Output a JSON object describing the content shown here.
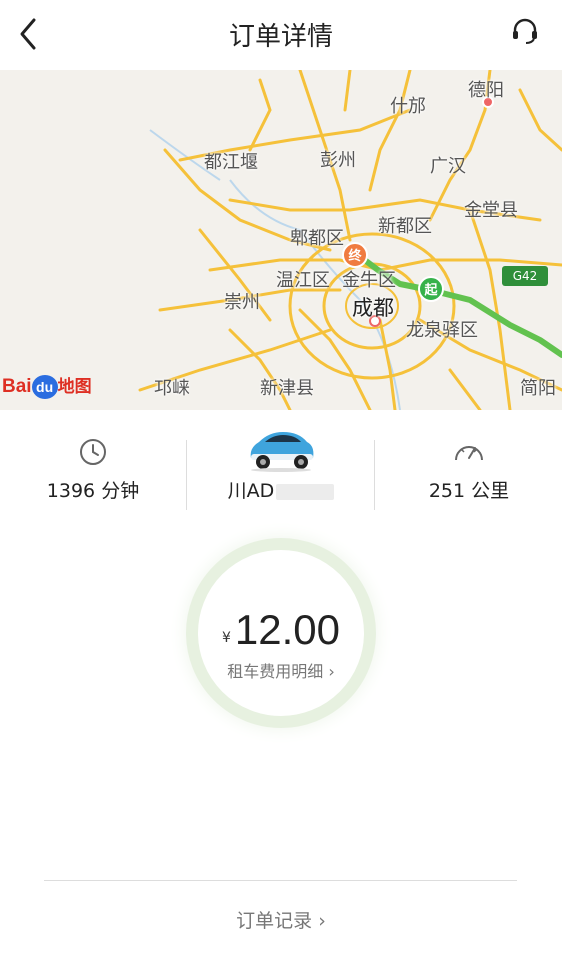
{
  "header": {
    "title": "订单详情",
    "back_icon": "chevron-left-icon",
    "support_icon": "headset-icon"
  },
  "map": {
    "cities": {
      "deyang": "德阳",
      "shifang": "什邡",
      "dujiangyan": "都江堰",
      "pengzhou": "彭州",
      "guanghan": "广汉",
      "xindu": "新都区",
      "jintang": "金堂县",
      "pidu": "郫都区",
      "wenjiang": "温江区",
      "jinniu": "金牛区",
      "chongzhou": "崇州",
      "chengdu": "成都",
      "longquanyi": "龙泉驿区",
      "qionglai": "邛崃",
      "xinjin": "新津县",
      "jianyang": "简阳"
    },
    "highway_badge": "G42",
    "end_marker": "终",
    "start_marker": "起",
    "logo_text_en": "Bai",
    "logo_text_du": "du",
    "logo_text_cn": "地图",
    "route_color": "#62c24f"
  },
  "trip": {
    "duration": "1396 分钟",
    "plate": "川AD",
    "distance": "251 公里"
  },
  "fare": {
    "currency": "¥",
    "amount": "12.00",
    "detail_link": "租车费用明细 ›"
  },
  "footer": {
    "order_record_link": "订单记录 ›"
  },
  "colors": {
    "accent_green": "#36b24a",
    "end_orange": "#f07b3f",
    "road_yellow": "#f5c13a",
    "circle_ring": "#e7f1e0"
  }
}
